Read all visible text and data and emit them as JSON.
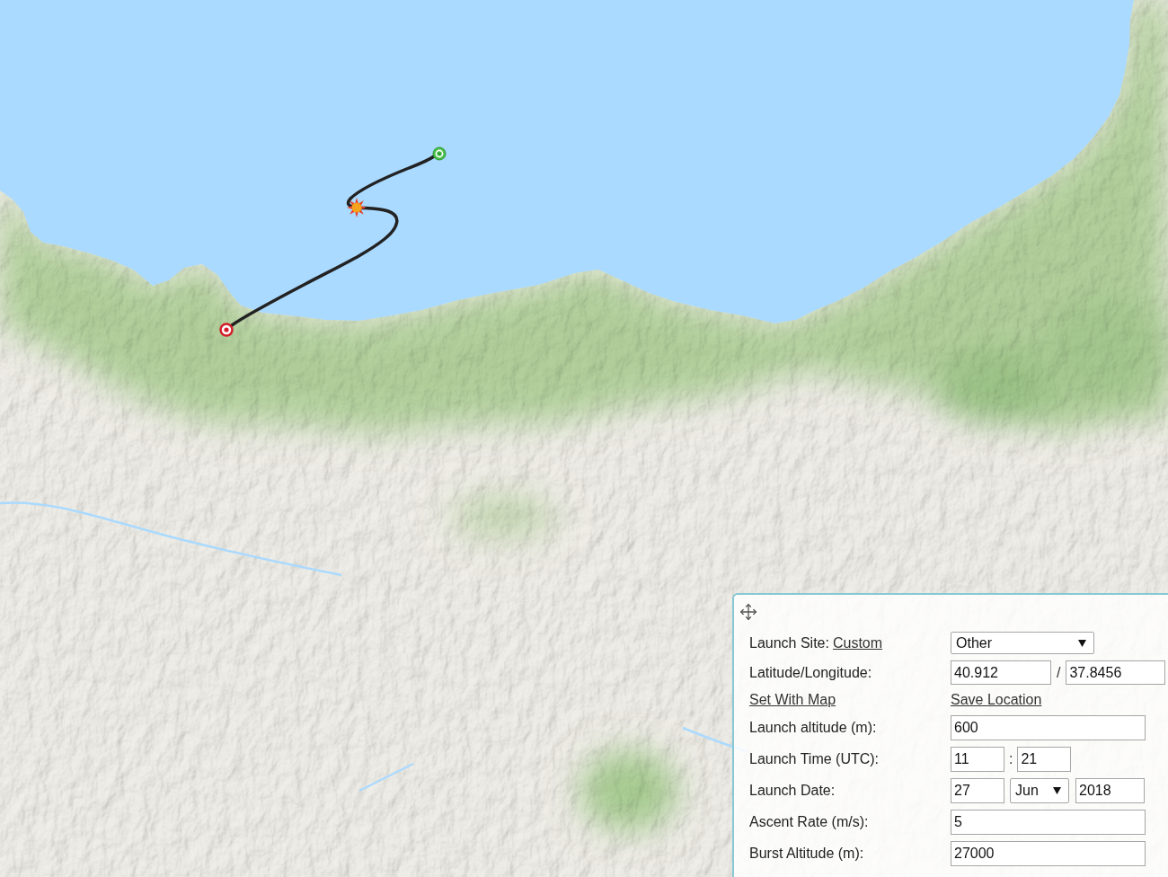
{
  "settings_panel": {
    "rows": [
      {
        "kind": "select",
        "label": "Launch Site:",
        "link": "Custom",
        "value": "Other"
      },
      {
        "kind": "pair",
        "label": "Latitude/Longitude:",
        "values": [
          "40.912",
          "37.8456"
        ],
        "separator": "/"
      },
      {
        "kind": "links",
        "links": [
          "Set With Map",
          "Save Location"
        ]
      },
      {
        "kind": "text",
        "label": "Launch altitude (m):",
        "value": "600"
      },
      {
        "kind": "time",
        "label": "Launch Time (UTC):",
        "values": [
          "11",
          "21"
        ],
        "separator": ":"
      },
      {
        "kind": "date",
        "label": "Launch Date:",
        "day": "27",
        "month": "Jun",
        "year": "2018"
      },
      {
        "kind": "text",
        "label": "Ascent Rate (m/s):",
        "value": "5"
      },
      {
        "kind": "text",
        "label": "Burst Altitude (m):",
        "value": "27000"
      }
    ]
  }
}
